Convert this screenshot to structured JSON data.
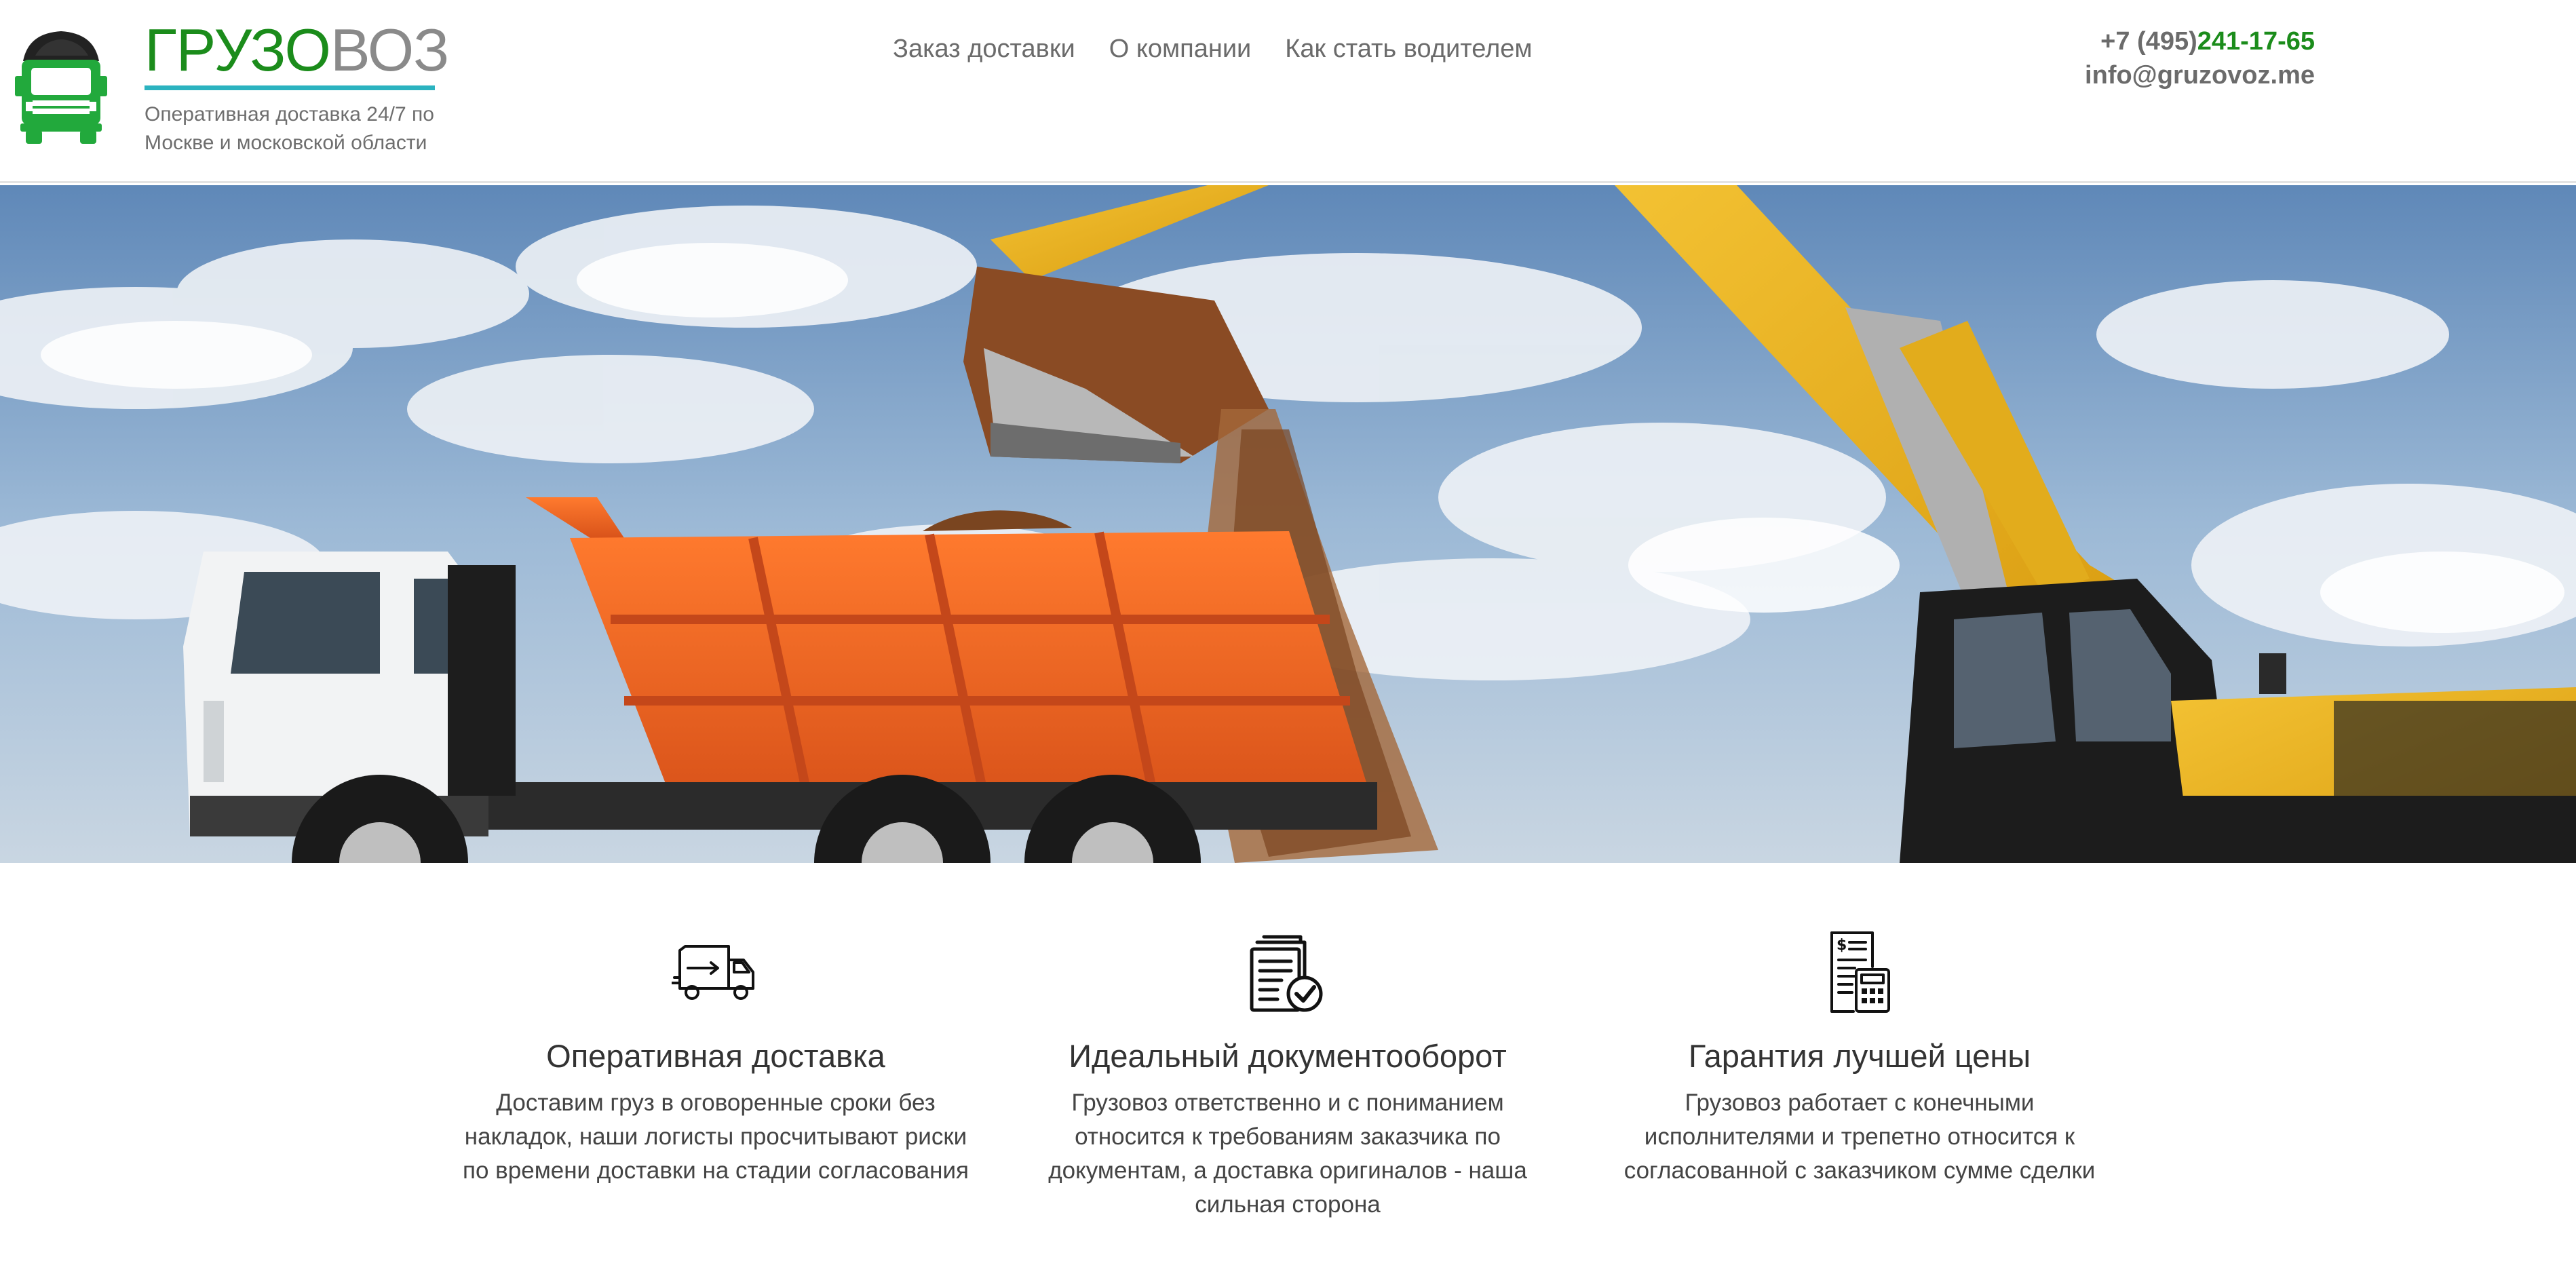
{
  "brand": {
    "name_part1": "ГРУЗО",
    "name_part2": "ВОЗ",
    "tagline": "Оперативная доставка 24/7 по Москве и московской области",
    "accent_green": "#1b8c1b",
    "accent_teal": "#2bb3c0"
  },
  "nav": {
    "items": [
      {
        "label": "Заказ доставки"
      },
      {
        "label": "О компании"
      },
      {
        "label": "Как стать водителем"
      }
    ]
  },
  "contacts": {
    "phone_prefix": "+7 (495)",
    "phone_number": "241-17-65",
    "email": "info@gruzovoz.me"
  },
  "hero": {
    "image": "dump-truck-and-excavator-photo"
  },
  "features": [
    {
      "icon": "delivery-truck-icon",
      "title": "Оперативная доставка",
      "text": "Доставим груз в оговоренные сроки без накладок, наши логисты просчитывают риски по времени доставки на стадии согласования"
    },
    {
      "icon": "documents-check-icon",
      "title": "Идеальный документооборот",
      "text": "Грузовоз ответственно и с пониманием относится к требованиям заказчика по документам, а доставка оригиналов - наша сильная сторона"
    },
    {
      "icon": "invoice-calculator-icon",
      "title": "Гарантия лучшей цены",
      "text": "Грузовоз работает с конечными исполнителями и трепетно относится к согласованной с заказчиком сумме сделки"
    }
  ]
}
